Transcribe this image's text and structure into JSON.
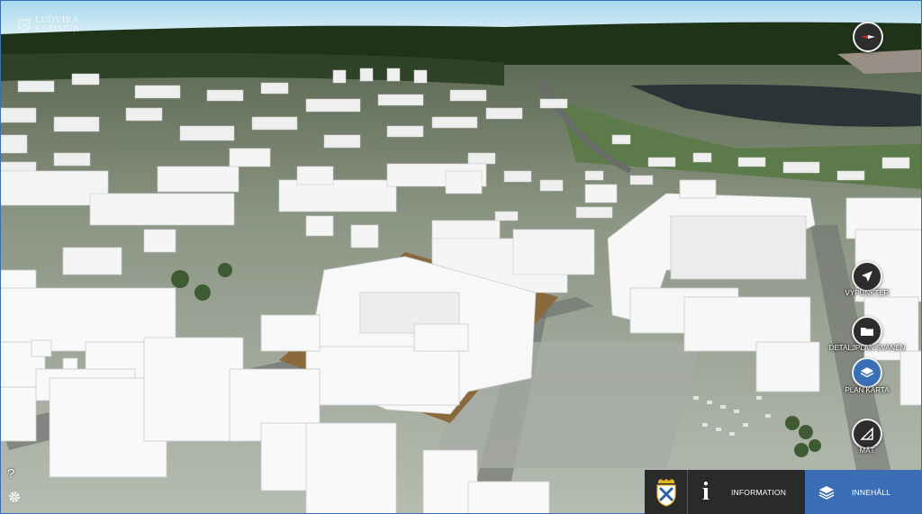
{
  "brand": {
    "line1": "LUDVIKA",
    "line2": "KOMMUN"
  },
  "controls": {
    "compass_icon": "compass-icon",
    "help_label": "?",
    "settings_icon": "gear-icon"
  },
  "right_buttons": [
    {
      "id": "vypunkter",
      "label": "VYPUNKTER",
      "icon": "navigation-arrow-icon"
    },
    {
      "id": "detaljplan",
      "label": "DETALJPLAN SVANEN",
      "icon": "folder-icon"
    },
    {
      "id": "plankarta",
      "label": "PLAN KARTA",
      "icon": "layers-icon"
    },
    {
      "id": "mat",
      "label": "MÄT",
      "icon": "ruler-triangle-icon"
    }
  ],
  "bottom_bar": {
    "crest_icon": "municipal-crest-icon",
    "information_label": "INFORMATION",
    "content_label": "INNEHÅLL"
  },
  "colors": {
    "accent": "#3a6fb6",
    "dark": "#2a2a2a",
    "sky": "#bfe3f2"
  }
}
